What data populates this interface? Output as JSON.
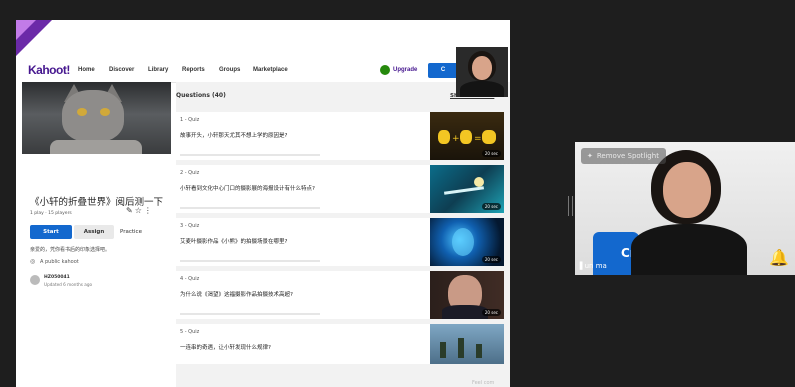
{
  "nav": {
    "logo": "Kahoot!",
    "links": [
      "Home",
      "Discover",
      "Library",
      "Reports",
      "Groups",
      "Marketplace"
    ],
    "upgrade": "Upgrade",
    "create": "C"
  },
  "kahoot": {
    "title": "《小轩的折叠世界》阅后测一下",
    "stats": "1 play · 15 players",
    "start": "Start",
    "assign": "Assign",
    "practice": "Practice",
    "description": "亲爱的，凭你看书后的印象选择吧。",
    "visibility": "A public kahoot",
    "author": "HZ050041",
    "updated": "Updated 6 months ago"
  },
  "questions": {
    "header": "Questions (40)",
    "show_answers": "Show answers",
    "items": [
      {
        "num": "1 - Quiz",
        "text": "故事开头，小轩那天尤其不想上学的原因是?",
        "time": "20 sec"
      },
      {
        "num": "2 - Quiz",
        "text": "小轩看到文化中心门口的摄影展的海报设计有什么特点?",
        "time": "20 sec"
      },
      {
        "num": "3 - Quiz",
        "text": "艾麦叶摄影作品《小熊》的拍摄场景在哪里?",
        "time": "20 sec"
      },
      {
        "num": "4 - Quiz",
        "text": "为什么说《渴望》这福摄影作品拍摄技术高超?",
        "time": "20 sec"
      },
      {
        "num": "5 - Quiz",
        "text": "一连串的奇遇，让小轩发现什么规律?",
        "time": ""
      }
    ]
  },
  "footer": "Feel com",
  "self_view": {
    "spotlight": "Remove Spotlight",
    "name": "un ma",
    "button_fragment": "Cr"
  },
  "colors": {
    "brand_purple": "#46178f",
    "primary_blue": "#1368ce",
    "upgrade_green": "#26890c"
  }
}
